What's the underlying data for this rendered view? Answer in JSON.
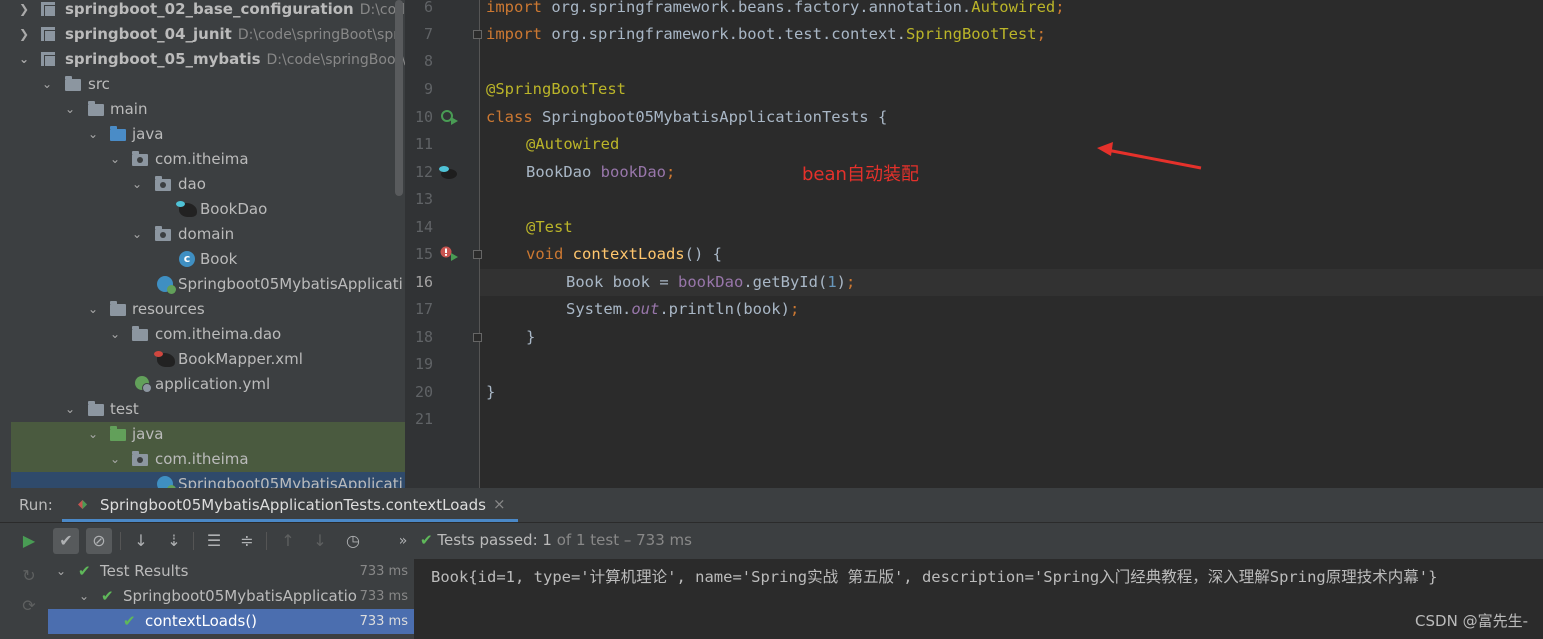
{
  "project_tree": [
    {
      "label": "springboot_02_base_configuration",
      "path": "D:\\code\\s",
      "bold": true
    },
    {
      "label": "springboot_04_junit",
      "path": "D:\\code\\springBoot\\spri",
      "bold": true
    },
    {
      "label": "springboot_05_mybatis",
      "path": "D:\\code\\springBoot\\s",
      "bold": true
    },
    {
      "label": "src"
    },
    {
      "label": "main"
    },
    {
      "label": "java"
    },
    {
      "label": "com.itheima"
    },
    {
      "label": "dao"
    },
    {
      "label": "BookDao"
    },
    {
      "label": "domain"
    },
    {
      "label": "Book"
    },
    {
      "label": "Springboot05MybatisApplicati"
    },
    {
      "label": "resources"
    },
    {
      "label": "com.itheima.dao"
    },
    {
      "label": "BookMapper.xml"
    },
    {
      "label": "application.yml"
    },
    {
      "label": "test"
    },
    {
      "label": "java"
    },
    {
      "label": "com.itheima"
    },
    {
      "label": "Springboot05MybatisApplicati"
    }
  ],
  "editor": {
    "line_numbers": [
      "6",
      "7",
      "8",
      "9",
      "10",
      "11",
      "12",
      "13",
      "14",
      "15",
      "16",
      "17",
      "18",
      "19",
      "20",
      "21"
    ],
    "lines": {
      "l6_import": "import",
      "l6_pkg": " org.springframework.beans.factory.annotation.",
      "l6_cls": "Autowired",
      "l6_semi": ";",
      "l7_import": "import",
      "l7_pkg": " org.springframework.boot.test.context.",
      "l7_cls": "SpringBootTest",
      "l7_semi": ";",
      "l9_ann": "@SpringBootTest",
      "l10_kw": "class",
      "l10_rest": " Springboot05MybatisApplicationTests {",
      "l11_ann": "@Autowired",
      "l12_type": "BookDao ",
      "l12_field": "bookDao",
      "l12_semi": ";",
      "l14_ann": "@Test",
      "l15_kw": "void",
      "l15_fn": " contextLoads",
      "l15_rest": "() {",
      "l16_a": "Book book = ",
      "l16_field": "bookDao",
      "l16_b": ".getById(",
      "l16_num": "1",
      "l16_c": ")",
      "l16_semi": ";",
      "l17_a": "System.",
      "l17_field": "out",
      "l17_b": ".println(book)",
      "l17_semi": ";",
      "l18": "}",
      "l20": "}"
    },
    "callout": "bean自动装配"
  },
  "run_panel": {
    "label": "Run:",
    "tab_title": "Springboot05MybatisApplicationTests.contextLoads",
    "close_glyph": "×",
    "status_prefix": "Tests passed:",
    "status_count": "1",
    "status_suffix": "of 1 test – 733 ms",
    "test_tree": [
      {
        "label": "Test Results",
        "time": "733 ms"
      },
      {
        "label": "Springboot05MybatisApplicatio",
        "time": "733 ms"
      },
      {
        "label": "contextLoads()",
        "time": "733 ms"
      }
    ],
    "console_output": "Book{id=1, type='计算机理论', name='Spring实战 第五版', description='Spring入门经典教程，深入理解Spring原理技术内幕'}",
    "watermark": "CSDN @富先生-"
  },
  "colors": {
    "accent": "#4a88c7",
    "pass_green": "#5fb85a",
    "callout_red": "#e5312b"
  }
}
